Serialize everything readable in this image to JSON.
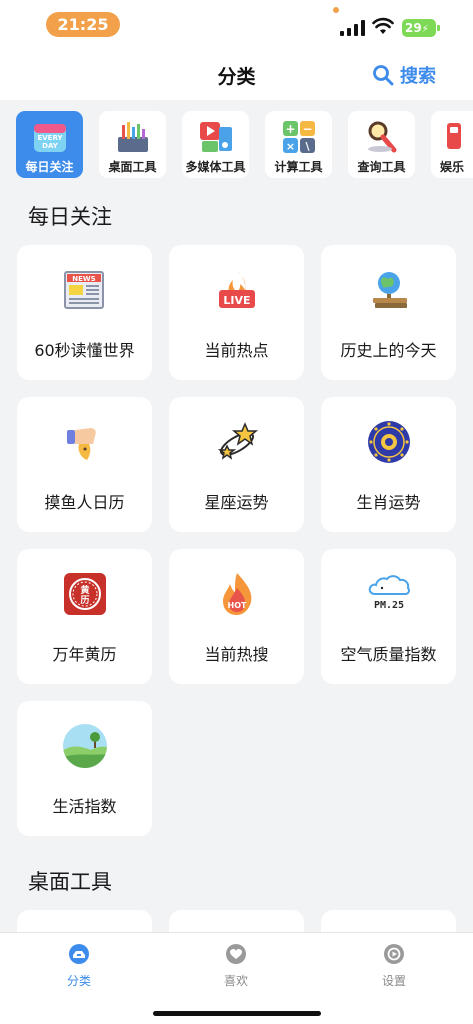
{
  "status_bar": {
    "time": "21:25",
    "battery": "29"
  },
  "header": {
    "title": "分类",
    "search_label": "搜索",
    "search_icon": "search-icon"
  },
  "tabs": [
    {
      "label": "每日关注",
      "icon": "everyday-calendar-icon",
      "active": true
    },
    {
      "label": "桌面工具",
      "icon": "desk-tools-icon"
    },
    {
      "label": "多媒体工具",
      "icon": "multimedia-icon"
    },
    {
      "label": "计算工具",
      "icon": "calculator-icon"
    },
    {
      "label": "查询工具",
      "icon": "magnifier-query-icon"
    },
    {
      "label": "娱乐",
      "icon": "entertainment-icon"
    }
  ],
  "sections": [
    {
      "title": "每日关注",
      "items": [
        {
          "label": "60秒读懂世界",
          "icon": "newspaper-icon"
        },
        {
          "label": "当前热点",
          "icon": "live-fire-icon"
        },
        {
          "label": "历史上的今天",
          "icon": "globe-books-icon"
        },
        {
          "label": "摸鱼人日历",
          "icon": "fish-hand-icon"
        },
        {
          "label": "星座运势",
          "icon": "shooting-star-icon"
        },
        {
          "label": "生肖运势",
          "icon": "zodiac-wheel-icon"
        },
        {
          "label": "万年黄历",
          "icon": "almanac-icon"
        },
        {
          "label": "当前热搜",
          "icon": "hot-flame-icon"
        },
        {
          "label": "空气质量指数",
          "icon": "pm25-cloud-icon"
        },
        {
          "label": "生活指数",
          "icon": "landscape-icon"
        }
      ]
    },
    {
      "title": "桌面工具",
      "items": []
    }
  ],
  "bottom_nav": [
    {
      "label": "分类",
      "icon": "category-icon",
      "active": true
    },
    {
      "label": "喜欢",
      "icon": "heart-icon"
    },
    {
      "label": "设置",
      "icon": "settings-icon"
    }
  ],
  "colors": {
    "accent": "#3d8bea",
    "time_pill": "#f2a04a",
    "battery": "#7ed957",
    "background": "#f2f3f5"
  }
}
